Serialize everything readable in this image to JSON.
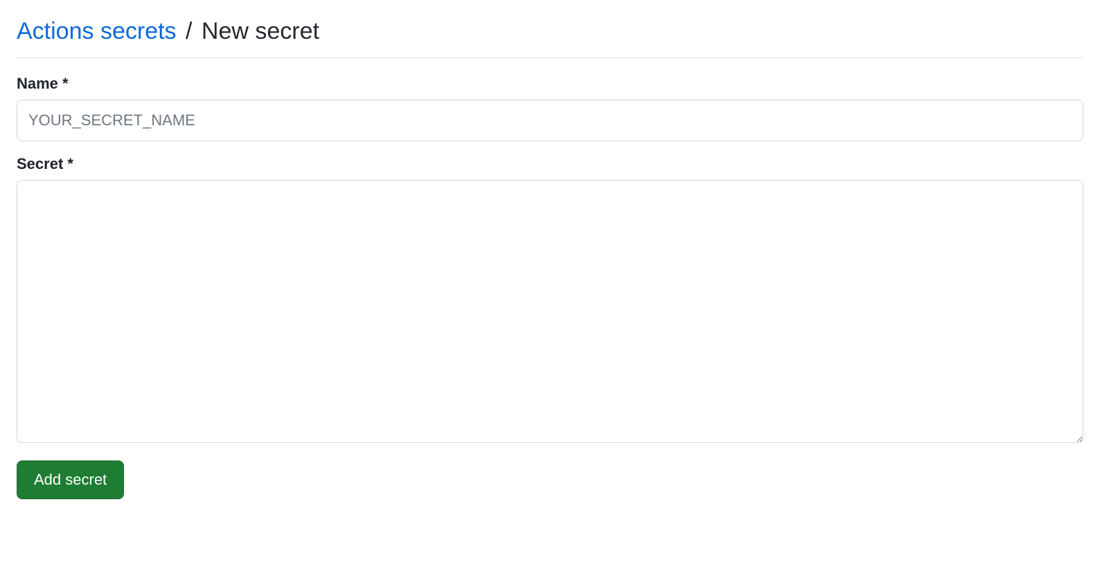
{
  "header": {
    "breadcrumb_link": "Actions secrets",
    "separator": "/",
    "subtitle": "New secret"
  },
  "form": {
    "name_label": "Name *",
    "name_placeholder": "YOUR_SECRET_NAME",
    "name_value": "",
    "secret_label": "Secret *",
    "secret_value": "",
    "submit_label": "Add secret"
  }
}
